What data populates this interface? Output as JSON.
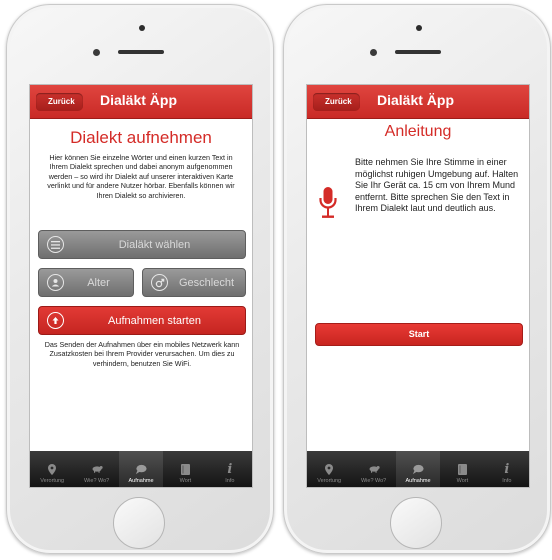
{
  "colors": {
    "brand_red": "#d42b27",
    "tab_bar": "#1e1e1e",
    "button_gray": "#858585"
  },
  "left_screen": {
    "nav": {
      "back_label": "Zurück",
      "title": "Dialäkt Äpp"
    },
    "heading": "Dialekt aufnehmen",
    "intro": "Hier können Sie einzelne Wörter und einen kurzen Text in Ihrem Dialekt sprechen und dabei anonym aufgenommen werden – so wird ihr Dialekt auf unserer interaktiven Karte verlinkt und für andere Nutzer hörbar. Ebenfalls können wir Ihren Dialekt so archivieren.",
    "buttons": {
      "dialect": {
        "label": "Dialäkt wählen",
        "icon": "list-icon"
      },
      "age": {
        "label": "Alter",
        "icon": "person-icon"
      },
      "gender": {
        "label": "Geschlecht",
        "icon": "gender-icon"
      },
      "record": {
        "label": "Aufnahmen starten",
        "icon": "upload-icon"
      }
    },
    "footnote": "Das Senden der Aufnahmen über ein mobiles Netzwerk kann Zusatzkosten bei Ihrem Provider verursachen. Um dies zu verhindern, benutzen Sie WiFi."
  },
  "right_screen": {
    "nav": {
      "back_label": "Zurück",
      "title": "Dialäkt Äpp"
    },
    "heading": "Anleitung",
    "instruction": "Bitte nehmen Sie Ihre Stimme in einer möglichst ruhigen Umgebung auf. Halten Sie Ihr Gerät ca. 15 cm von Ihrem Mund entfernt. Bitte sprechen Sie den Text in Ihrem Dialekt laut und deutlich aus.",
    "start_label": "Start"
  },
  "tabs": [
    {
      "label": "Verortung",
      "icon": "pin-icon"
    },
    {
      "label": "Wie? Wo?",
      "icon": "animal-icon"
    },
    {
      "label": "Aufnahme",
      "icon": "chat-icon"
    },
    {
      "label": "Wort",
      "icon": "book-icon"
    },
    {
      "label": "Info",
      "icon": "info-icon"
    }
  ],
  "active_tab": "Aufnahme"
}
